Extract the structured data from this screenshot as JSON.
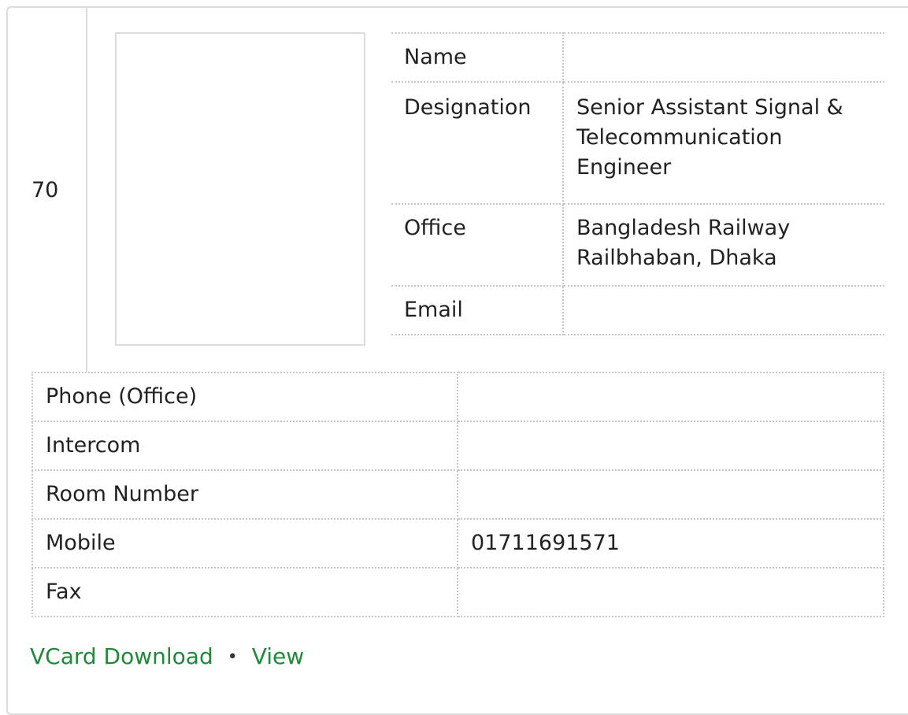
{
  "serial_number": "70",
  "profile": {
    "name_label": "Name",
    "name_value": "",
    "designation_label": "Designation",
    "designation_value": "Senior Assistant Signal & Telecommunication Engineer",
    "office_label": "Office",
    "office_value": "Bangladesh Railway Railbhaban, Dhaka",
    "email_label": "Email",
    "email_value": ""
  },
  "contact": {
    "phone_office_label": "Phone (Office)",
    "phone_office_value": "",
    "intercom_label": "Intercom",
    "intercom_value": "",
    "room_number_label": "Room Number",
    "room_number_value": "",
    "mobile_label": "Mobile",
    "mobile_value": "01711691571",
    "fax_label": "Fax",
    "fax_value": ""
  },
  "actions": {
    "vcard_label": "VCard Download",
    "separator": "•",
    "view_label": "View"
  },
  "colors": {
    "link": "#1e8a3a",
    "border": "#dcdcdc"
  }
}
